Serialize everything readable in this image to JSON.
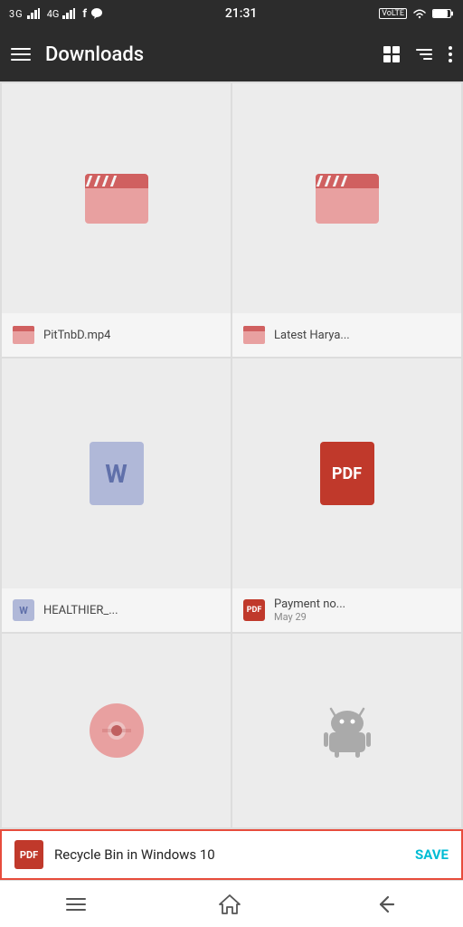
{
  "status_bar": {
    "left": "3G  4G  f  ●",
    "time": "21:31",
    "right": "VoLTE  WiFi  Battery"
  },
  "header": {
    "menu_label": "menu",
    "title": "Downloads",
    "grid_view_label": "grid view",
    "sort_label": "sort",
    "more_label": "more options"
  },
  "files": [
    {
      "id": "file-1",
      "name": "PitTnbD.mp4",
      "type": "video",
      "date": null,
      "preview_type": "video"
    },
    {
      "id": "file-2",
      "name": "Latest Harya...",
      "type": "video",
      "date": null,
      "preview_type": "video"
    },
    {
      "id": "file-3",
      "name": "HEALTHIER_...",
      "type": "word",
      "date": null,
      "preview_type": "word"
    },
    {
      "id": "file-4",
      "name": "Payment no...",
      "type": "pdf",
      "date": "May 29",
      "preview_type": "pdf"
    },
    {
      "id": "file-5",
      "name": "",
      "type": "image",
      "date": null,
      "preview_type": "image"
    },
    {
      "id": "file-6",
      "name": "",
      "type": "android",
      "date": null,
      "preview_type": "android"
    }
  ],
  "snackbar": {
    "icon_type": "pdf",
    "text": "Recycle Bin in Windows 10",
    "action": "SAVE"
  },
  "bottom_nav": {
    "menu_label": "menu",
    "home_label": "home",
    "back_label": "back"
  }
}
